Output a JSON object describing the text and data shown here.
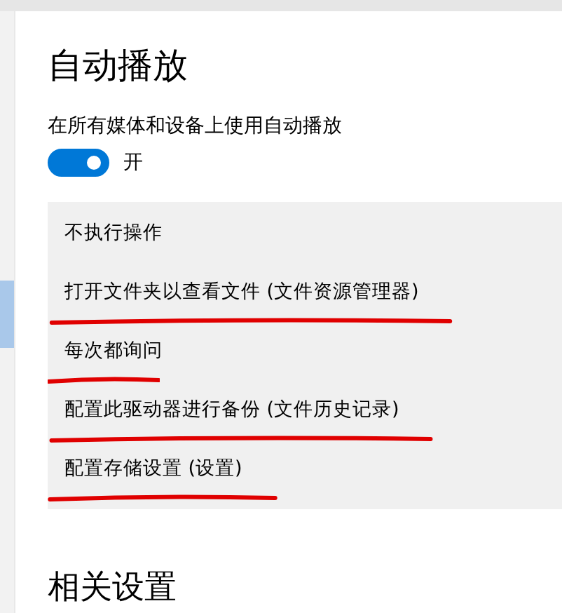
{
  "title": "自动播放",
  "setting": {
    "label": "在所有媒体和设备上使用自动播放",
    "toggle": {
      "on": true,
      "state_label": "开"
    }
  },
  "dropdown": {
    "options": [
      {
        "label": "不执行操作",
        "underlined": false
      },
      {
        "label": "打开文件夹以查看文件 (文件资源管理器)",
        "underlined": true
      },
      {
        "label": "每次都询问",
        "underlined": true
      },
      {
        "label": "配置此驱动器进行备份 (文件历史记录)",
        "underlined": true
      },
      {
        "label": "配置存储设置 (设置)",
        "underlined": true
      }
    ]
  },
  "related_heading": "相关设置"
}
